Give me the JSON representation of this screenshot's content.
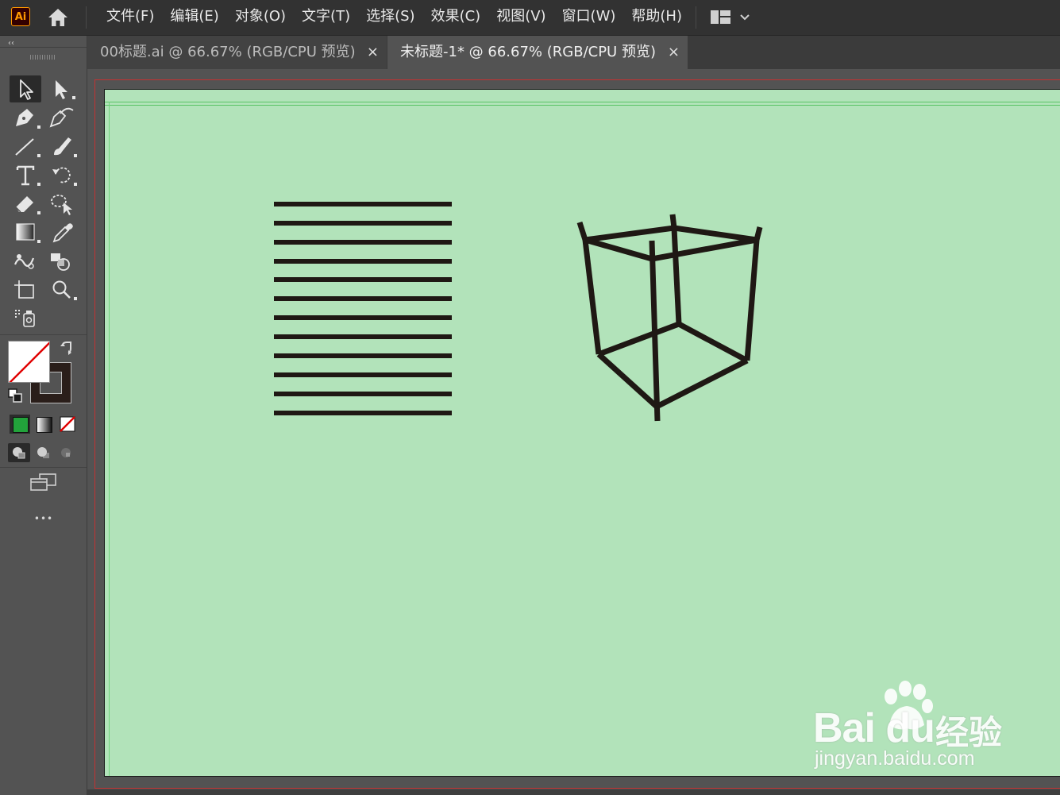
{
  "app": {
    "logo_text": "Ai"
  },
  "menu": {
    "items": [
      "文件(F)",
      "编辑(E)",
      "对象(O)",
      "文字(T)",
      "选择(S)",
      "效果(C)",
      "视图(V)",
      "窗口(W)",
      "帮助(H)"
    ]
  },
  "toolbar": {
    "collapse": "‹‹",
    "more": "•••"
  },
  "tabs": [
    {
      "label": "00标题.ai @ 66.67% (RGB/CPU 预览)",
      "close": "×",
      "active": false
    },
    {
      "label": "未标题-1* @ 66.67% (RGB/CPU 预览)",
      "close": "×",
      "active": true
    }
  ],
  "colors": {
    "artboard_bg": "#b2e3ba",
    "stroke": "#1f1814",
    "accent_orange": "#ff9a00",
    "fill_swatch": "#22a33b"
  },
  "watermark": {
    "brand": "Bai du",
    "cn": "经验",
    "url": "jingyan.baidu.com"
  }
}
